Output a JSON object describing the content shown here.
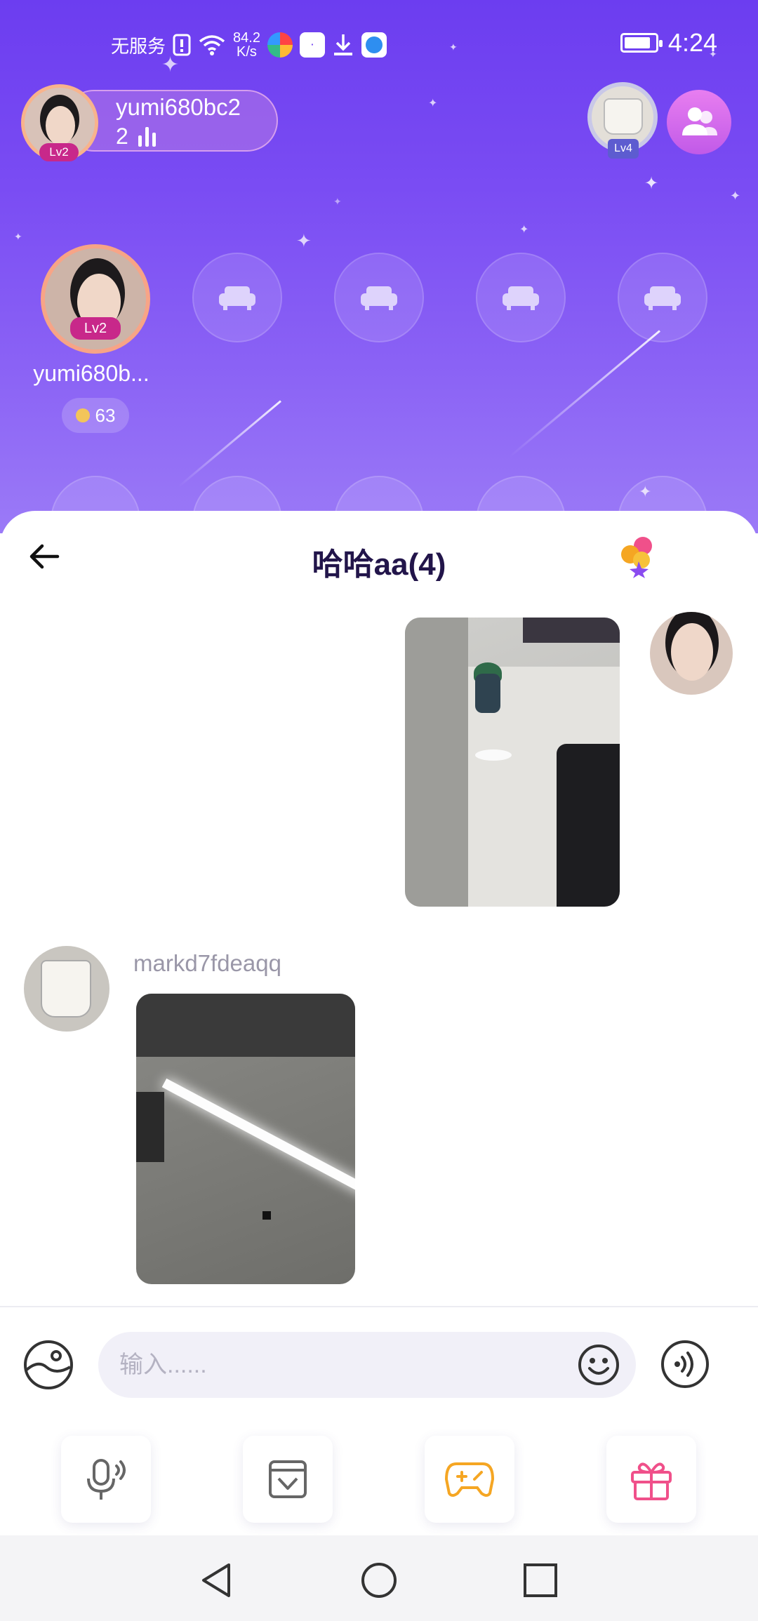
{
  "status_bar": {
    "carrier": "无服务",
    "speed_value": "84.2",
    "speed_unit": "K/s",
    "time": "4:24"
  },
  "room": {
    "owner": {
      "name": "yumi680bc2",
      "online_count": "2",
      "level": "Lv2"
    },
    "rank_level": "Lv4",
    "host_seat": {
      "name": "yumi680b...",
      "level": "Lv2",
      "coins": "63"
    },
    "icons": {
      "empty_seat": "sofa-icon",
      "friends": "users-icon"
    }
  },
  "chat": {
    "title": "哈哈aa(4)",
    "messages": [
      {
        "side": "right",
        "type": "image",
        "content": "photo-figurine-keyboard"
      },
      {
        "side": "left",
        "sender": "markd7fdeaqq",
        "type": "image",
        "content": "photo-ceiling-light"
      }
    ],
    "input_placeholder": "输入......"
  },
  "colors": {
    "room_gradient_top": "#6c3df0",
    "room_gradient_bottom": "#9b7af7",
    "title_color": "#22154a",
    "accent_pink": "#c8288a"
  }
}
